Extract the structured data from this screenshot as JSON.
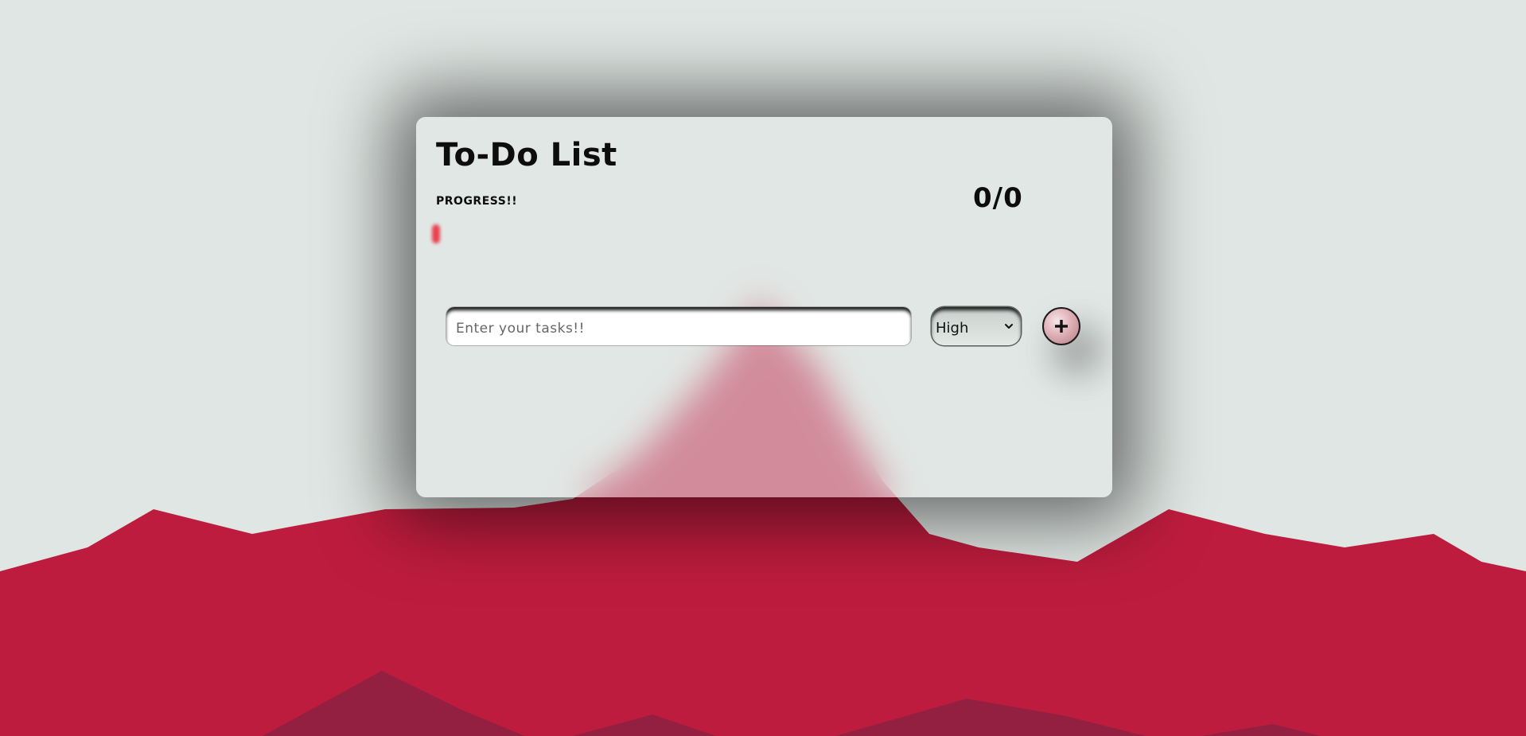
{
  "app": {
    "title": "To-Do List"
  },
  "progress": {
    "label": "PROGRESS!!",
    "completed": 0,
    "total": 0,
    "counter_text": "0/0",
    "fill_fraction": 0.0,
    "fill_color": "#e8414e"
  },
  "task_form": {
    "input_placeholder": "Enter your tasks!!",
    "input_value": "",
    "priority_options": [
      "High"
    ],
    "priority_selected": "High",
    "add_button_icon": "plus-icon"
  },
  "theme": {
    "background": "#e0e6e3",
    "mountain_red": "#be1c3e",
    "mountain_dark": "#8c2142",
    "card_tint": "#e2e8e5"
  }
}
